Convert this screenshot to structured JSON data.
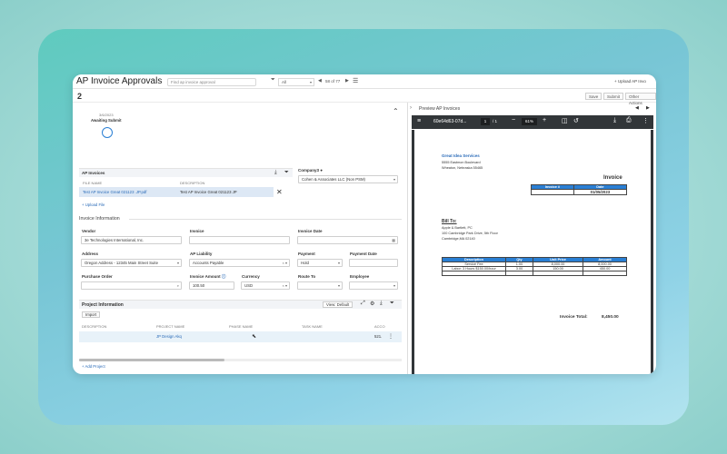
{
  "app": {
    "title": "AP Invoice Approvals",
    "search_placeholder": "Find ap invoice approval",
    "filter": "All",
    "record_count": "58 of 77",
    "upload_link": "+ Upload AP Invo"
  },
  "record": {
    "number": "2",
    "save_label": "Save",
    "submit_label": "Submit",
    "other_actions_label": "Other Actions"
  },
  "workflow": {
    "date": "3/6/2023",
    "step": "Awaiting Submit"
  },
  "ap_invoices": {
    "title": "AP Invoices",
    "col_file": "FILE NAME",
    "col_desc": "DESCRIPTION",
    "file": "Test AP Invoice Great 021123 .JP.pdf",
    "description": "Test AP Invoice Great 021123 JP",
    "upload_label": "+ Upload File"
  },
  "company": {
    "label": "Company3 ●",
    "value": "Cohen & Associates LLC (Non PSM)"
  },
  "invoice_info": {
    "title": "Invoice Information",
    "vendor_label": "Vendor",
    "vendor_value": "3e Technologies International, Inc.",
    "invoice_label": "Invoice",
    "invoice_date_label": "Invoice Date",
    "address_label": "Address",
    "address_value": "Oregon Address - 12345 Main Street Suite",
    "ap_liability_label": "AP Liability",
    "ap_liability_value": "Accounts Payable",
    "payment_label": "Payment",
    "payment_value": "Hold",
    "payment_date_label": "Payment Date",
    "po_label": "Purchase Order",
    "amount_label": "Invoice Amount",
    "amount_value": "100.50",
    "currency_label": "Currency",
    "currency_value": "USD",
    "route_label": "Route To",
    "employee_label": "Employee"
  },
  "project_info": {
    "title": "Project Information",
    "view_label": "View: Default",
    "import_label": "Import",
    "col_desc": "DESCRIPTION",
    "col_project": "PROJECT NAME",
    "col_phase": "PHASE NAME",
    "col_task": "TASK NAME",
    "col_acct": "ACCO",
    "row_project": "JP Design Akq",
    "row_acct": "521.",
    "add_label": "+ Add Project"
  },
  "preview": {
    "title": "Preview AP Invoices",
    "file_id": "60e64d63-07d...",
    "page_current": "1",
    "page_total": "/ 1",
    "zoom": "61%"
  },
  "invoice_doc": {
    "company_name": "Great Idea Services",
    "company_addr1": "5555 Eastmon Boulevard",
    "company_addr2": "Wheaton, Nebraska 55465",
    "heading": "Invoice",
    "inv_no_label": "Invoice #",
    "date_label": "Date",
    "date_value": "01/05/2023",
    "bill_to_label": "Bill To:",
    "bill_name": "Apple & Bartlett, PC",
    "bill_addr1": "100 Cambridge Park Drive, 5th Floor",
    "bill_addr2": "Cambridge,MA 02140",
    "col_desc": "Description",
    "col_qty": "Qty",
    "col_price": "Unit Price",
    "col_amount": "Amount",
    "row1_desc": "Service Fee",
    "row1_qty": "1.00",
    "row1_price": "8,000.00",
    "row1_amount": "8,000.00",
    "row2_desc": "Labor: 3 Hours $150.00/hour",
    "row2_qty": "3.00",
    "row2_price": "150.00",
    "row2_amount": "450.00",
    "total_label": "Invoice Total:",
    "total_value": "8,450.00"
  }
}
